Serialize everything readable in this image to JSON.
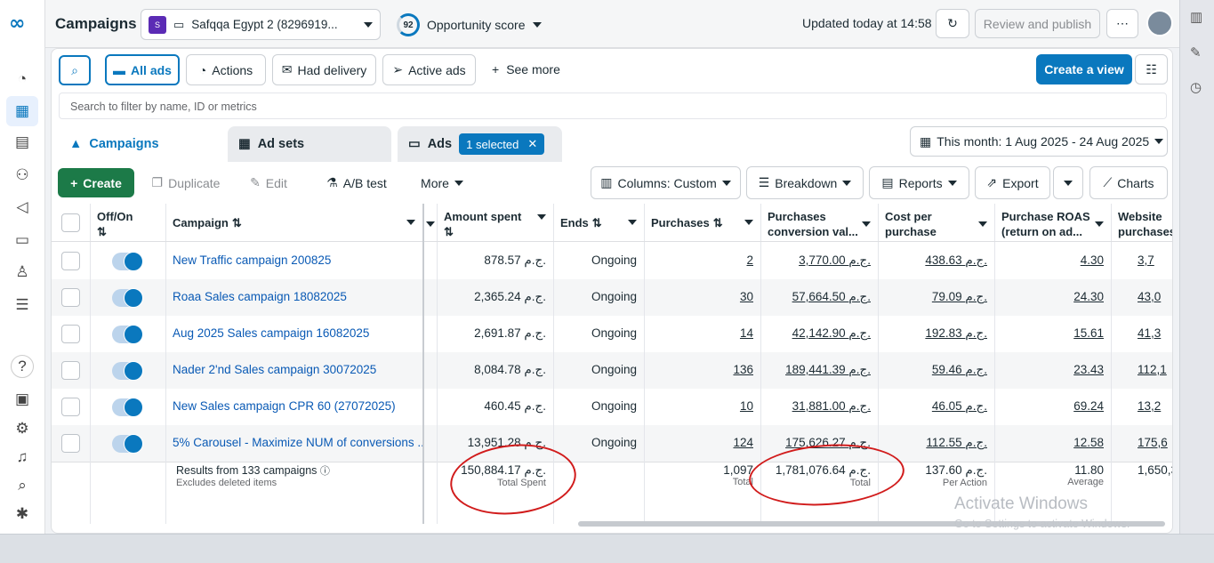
{
  "app": {
    "title": "Campaigns",
    "logo": "meta-logo"
  },
  "account": {
    "name": "Safqqa Egypt 2 (8296919..."
  },
  "opportunity": {
    "score": "92",
    "label": "Opportunity score"
  },
  "header": {
    "updated": "Updated today at 14:58",
    "review": "Review and publish"
  },
  "toolbar": {
    "all_ads": "All ads",
    "actions": "Actions",
    "had_delivery": "Had delivery",
    "active_ads": "Active ads",
    "see_more": "See more",
    "create_view": "Create a view"
  },
  "search": {
    "placeholder": "Search to filter by name, ID or metrics"
  },
  "tabs": {
    "campaigns": "Campaigns",
    "ad_sets": "Ad sets",
    "ads": "Ads",
    "selected": "1 selected"
  },
  "date_range": "This month: 1 Aug 2025 - 24 Aug 2025",
  "actions_bar": {
    "create": "Create",
    "duplicate": "Duplicate",
    "edit": "Edit",
    "ab_test": "A/B test",
    "more": "More",
    "columns": "Columns: Custom",
    "breakdown": "Breakdown",
    "reports": "Reports",
    "export": "Export",
    "charts": "Charts"
  },
  "columns": {
    "offon": "Off/On",
    "campaign": "Campaign",
    "amount_spent": "Amount spent",
    "ends": "Ends",
    "purchases": "Purchases",
    "conv_value": "Purchases conversion val...",
    "cost_per": "Cost per purchase",
    "roas": "Purchase ROAS (return on ad...",
    "website": "Website purchases"
  },
  "rows": [
    {
      "name": "New Traffic campaign 200825",
      "spent": "878.57 ج.م.",
      "ends": "Ongoing",
      "purchases": "2",
      "value": "3,770.00 ج.م.",
      "cost": "438.63 ج.م.",
      "roas": "4.30",
      "web": "3,7"
    },
    {
      "name": "Roaa Sales campaign 18082025",
      "spent": "2,365.24 ج.م.",
      "ends": "Ongoing",
      "purchases": "30",
      "value": "57,664.50 ج.م.",
      "cost": "79.09 ج.م.",
      "roas": "24.30",
      "web": "43,0"
    },
    {
      "name": "Aug 2025 Sales campaign 16082025",
      "spent": "2,691.87 ج.م.",
      "ends": "Ongoing",
      "purchases": "14",
      "value": "42,142.90 ج.م.",
      "cost": "192.83 ج.م.",
      "roas": "15.61",
      "web": "41,3"
    },
    {
      "name": "Nader 2'nd Sales campaign 30072025",
      "spent": "8,084.78 ج.م.",
      "ends": "Ongoing",
      "purchases": "136",
      "value": "189,441.39 ج.م.",
      "cost": "59.46 ج.م.",
      "roas": "23.43",
      "web": "112,1"
    },
    {
      "name": "New Sales campaign CPR 60 (27072025)",
      "spent": "460.45 ج.م.",
      "ends": "Ongoing",
      "purchases": "10",
      "value": "31,881.00 ج.م.",
      "cost": "46.05 ج.م.",
      "roas": "69.24",
      "web": "13,2"
    },
    {
      "name": "5% Carousel - Maximize NUM of conversions ...",
      "spent": "13,951.28 ج.م.",
      "ends": "Ongoing",
      "purchases": "124",
      "value": "175,626.27 ج.م.",
      "cost": "112.55 ج.م.",
      "roas": "12.58",
      "web": "175,6"
    }
  ],
  "totals": {
    "results": "Results from 133 campaigns",
    "excludes": "Excludes deleted items",
    "spent": "150,884.17 ج.م.",
    "spent_sub": "Total Spent",
    "purchases": "1,097",
    "purchases_sub": "Total",
    "value": "1,781,076.64 ج.م.",
    "value_sub": "Total",
    "cost": "137.60 ج.م.",
    "cost_sub": "Per Action",
    "roas": "11.80",
    "roas_sub": "Average",
    "web": "1,650,3"
  },
  "watermark": {
    "title": "Activate Windows",
    "sub": "Go to Settings to activate Windows."
  },
  "colors": {
    "brand": "#0a78be",
    "create": "#1c7a48",
    "annotation": "#d11c1c"
  }
}
